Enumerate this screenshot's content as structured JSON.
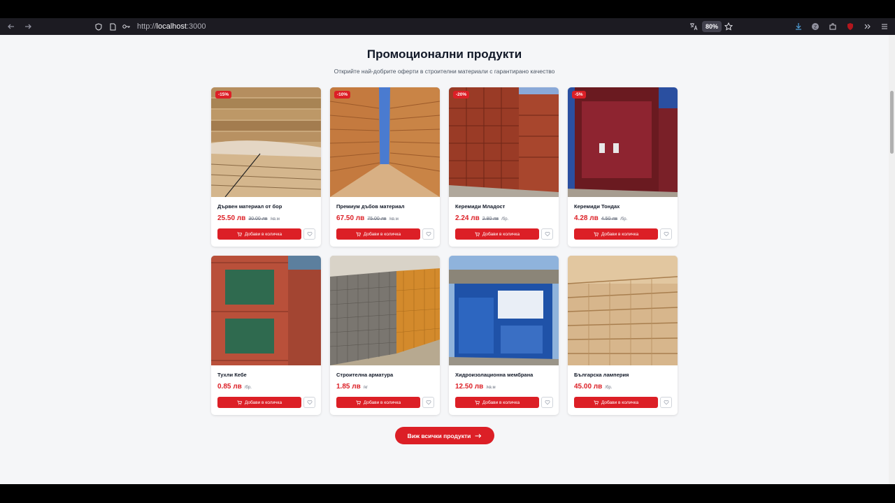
{
  "browser": {
    "url_prefix": "http://",
    "url_host": "localhost",
    "url_port": ":3000",
    "zoom": "80%"
  },
  "section": {
    "title": "Промоционални продукти",
    "subtitle": "Открийте най-добрите оферти в строителни материали с гарантирано качество"
  },
  "products": [
    {
      "name": "Дървен материал от бор",
      "price": "25.50 лв",
      "old_price": "30.00 лв",
      "unit": "/кв.м",
      "discount": "-15%",
      "add_label": "Добави в количка",
      "image": "pine-lumber"
    },
    {
      "name": "Премиум дъбов материал",
      "price": "67.50 лв",
      "old_price": "75.00 лв",
      "unit": "/кв.м",
      "discount": "-10%",
      "add_label": "Добави в количка",
      "image": "oak-lumber"
    },
    {
      "name": "Керемиди Младост",
      "price": "2.24 лв",
      "old_price": "2.80 лв",
      "unit": "/бр.",
      "discount": "-20%",
      "add_label": "Добави в количка",
      "image": "mladost-tiles"
    },
    {
      "name": "Керемиди Тондах",
      "price": "4.28 лв",
      "old_price": "4.50 лв",
      "unit": "/бр.",
      "discount": "-5%",
      "add_label": "Добави в количка",
      "image": "tondach-tiles"
    },
    {
      "name": "Тухли Кебе",
      "price": "0.85 лв",
      "old_price": "",
      "unit": "/бр.",
      "discount": "",
      "add_label": "Добави в количка",
      "image": "kebe-bricks"
    },
    {
      "name": "Строителна арматура",
      "price": "1.85 лв",
      "old_price": "",
      "unit": "/кг",
      "discount": "",
      "add_label": "Добави в количка",
      "image": "rebar-mesh"
    },
    {
      "name": "Хидроизолационна мембрана",
      "price": "12.50 лв",
      "old_price": "",
      "unit": "/кв.м",
      "discount": "",
      "add_label": "Добави в количка",
      "image": "ravaproof-membrane"
    },
    {
      "name": "Българска ламперия",
      "price": "45.00 лв",
      "old_price": "",
      "unit": "/бр.",
      "discount": "",
      "add_label": "Добави в количка",
      "image": "wood-paneling"
    }
  ],
  "view_all_label": "Виж всички продукти",
  "colors": {
    "accent": "#dc1f26",
    "background": "#f5f6f8"
  }
}
